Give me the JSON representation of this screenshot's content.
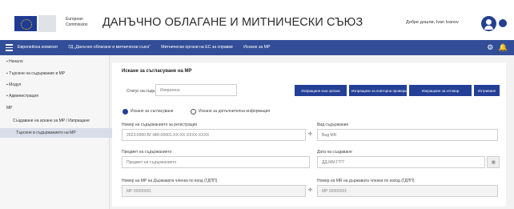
{
  "header": {
    "ec_text": "European Commission",
    "app_title": "ДАНЪЧНО ОБЛАГАНЕ И МИТНИЧЕСКИ СЪЮЗ",
    "user": "Добре дошли, Ivan Ivanov"
  },
  "nav": {
    "crumbs": [
      "Европейска комисия",
      "ГД „Данъчно облагане и митнически съюз“",
      "Митнически органи на ЕС за справки",
      "Искане за МР"
    ],
    "icons": [
      "gear-icon",
      "bell-icon"
    ]
  },
  "sidebar": {
    "items": [
      {
        "label": "Начало"
      },
      {
        "label": "Търсене на съдържание в МР"
      },
      {
        "label": "Модул"
      },
      {
        "label": "Администрация"
      },
      {
        "label": "МР"
      },
      {
        "label": "Създаване на искане за МР / Изпращане"
      },
      {
        "label": "Търсене в съдържанието на МР"
      }
    ]
  },
  "panel": {
    "title": "Искане за съгласуване на МР",
    "type_label": "Статус на съдържанието:",
    "type_value": "Изпратено",
    "buttons": [
      "Изпращане към органа",
      "Изпращане за повторна проверка",
      "Изпращане за отговор",
      "Изтриване"
    ],
    "radios": [
      "Искане за съгласуване",
      "Искане за допълнителна информация"
    ],
    "fields": [
      {
        "label": "Номер на съдържанието за регистрация",
        "value": "2023-0000-БГ-MR-00001-XX-XX-XXXX-XXXX"
      },
      {
        "label": "Вид съдържание",
        "value": "Вид MR"
      },
      {
        "label": "Предмет на съдържанието",
        "value": "Предмет на съдържанието"
      },
      {
        "label": "Дата на създаване",
        "value": "ДД.ММ.ГГГГ"
      },
      {
        "label": "Номер на МР на Държавата членка по вход (ГДПП)",
        "value": "МР 00000001"
      },
      {
        "label": "Номер на MR на държавата членка по изход (ГДПП)",
        "value": "МР 00000001"
      }
    ]
  }
}
